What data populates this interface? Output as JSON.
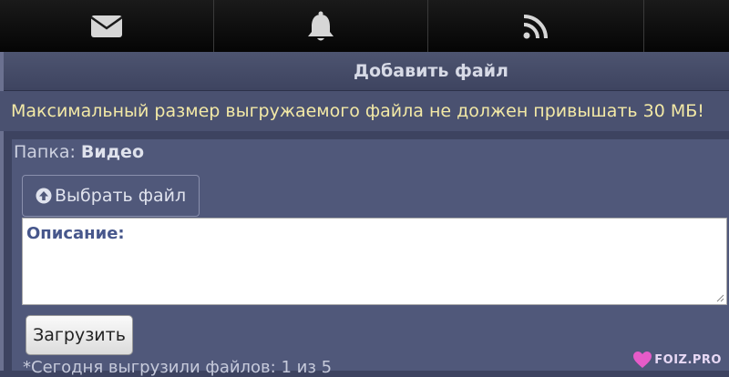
{
  "nav": {
    "tabs": [
      {
        "icon": "mail-icon"
      },
      {
        "icon": "bell-icon"
      },
      {
        "icon": "rss-icon"
      },
      {
        "icon": ""
      }
    ]
  },
  "header": {
    "title": "Добавить файл"
  },
  "notice": "Максимальный размер выгружаемого файла не должен привышать 30 МБ!",
  "folder": {
    "label": "Папка:",
    "name": "Видео"
  },
  "choose_button": "Выбрать файл",
  "description": {
    "label": "Описание:",
    "value": ""
  },
  "upload_button": "Загрузить",
  "today_text": "*Сегодня выгрузили файлов: 1 из 5",
  "watermark": "FOIZ.PRO",
  "colors": {
    "background": "#3d4360",
    "panel": "#50587a",
    "notice_text": "#f3e9a6",
    "description_label": "#47578c"
  }
}
